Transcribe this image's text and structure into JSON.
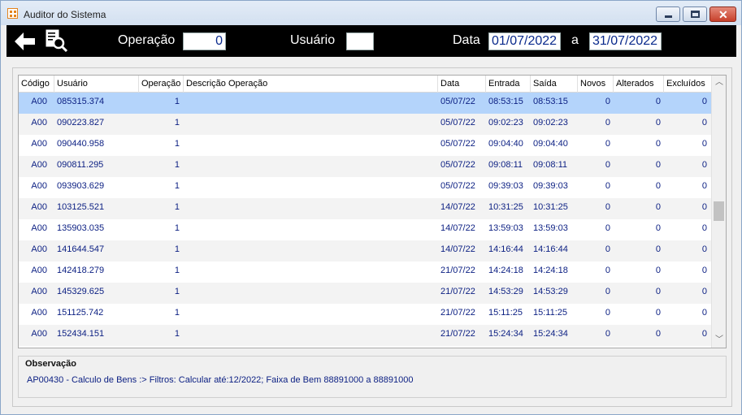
{
  "window": {
    "title": "Auditor do Sistema"
  },
  "toolbar": {
    "operacao_label": "Operação",
    "operacao_value": "0",
    "usuario_label": "Usuário",
    "usuario_value": "",
    "data_label": "Data",
    "data_from": "01/07/2022",
    "separator": "a",
    "data_to": "31/07/2022"
  },
  "grid": {
    "columns": [
      "Código",
      "Usuário",
      "Operação",
      "Descrição Operação",
      "Data",
      "Entrada",
      "Saída",
      "Novos",
      "Alterados",
      "Excluídos"
    ],
    "rows": [
      [
        "A00",
        "085315.374",
        "1",
        "",
        "05/07/22",
        "08:53:15",
        "08:53:15",
        "0",
        "0",
        "0"
      ],
      [
        "A00",
        "090223.827",
        "1",
        "",
        "05/07/22",
        "09:02:23",
        "09:02:23",
        "0",
        "0",
        "0"
      ],
      [
        "A00",
        "090440.958",
        "1",
        "",
        "05/07/22",
        "09:04:40",
        "09:04:40",
        "0",
        "0",
        "0"
      ],
      [
        "A00",
        "090811.295",
        "1",
        "",
        "05/07/22",
        "09:08:11",
        "09:08:11",
        "0",
        "0",
        "0"
      ],
      [
        "A00",
        "093903.629",
        "1",
        "",
        "05/07/22",
        "09:39:03",
        "09:39:03",
        "0",
        "0",
        "0"
      ],
      [
        "A00",
        "103125.521",
        "1",
        "",
        "14/07/22",
        "10:31:25",
        "10:31:25",
        "0",
        "0",
        "0"
      ],
      [
        "A00",
        "135903.035",
        "1",
        "",
        "14/07/22",
        "13:59:03",
        "13:59:03",
        "0",
        "0",
        "0"
      ],
      [
        "A00",
        "141644.547",
        "1",
        "",
        "14/07/22",
        "14:16:44",
        "14:16:44",
        "0",
        "0",
        "0"
      ],
      [
        "A00",
        "142418.279",
        "1",
        "",
        "21/07/22",
        "14:24:18",
        "14:24:18",
        "0",
        "0",
        "0"
      ],
      [
        "A00",
        "145329.625",
        "1",
        "",
        "21/07/22",
        "14:53:29",
        "14:53:29",
        "0",
        "0",
        "0"
      ],
      [
        "A00",
        "151125.742",
        "1",
        "",
        "21/07/22",
        "15:11:25",
        "15:11:25",
        "0",
        "0",
        "0"
      ],
      [
        "A00",
        "152434.151",
        "1",
        "",
        "21/07/22",
        "15:24:34",
        "15:24:34",
        "0",
        "0",
        "0"
      ]
    ],
    "selected_row": 0
  },
  "observacao": {
    "label": "Observação",
    "text": "AP00430 - Calculo de Bens :> Filtros: Calcular até:12/2022; Faixa de Bem 88891000 a 88891000"
  },
  "colors": {
    "selected_row": "#b4d4fb",
    "cell_text": "#0a1e82",
    "toolbar_bg": "#000000"
  }
}
